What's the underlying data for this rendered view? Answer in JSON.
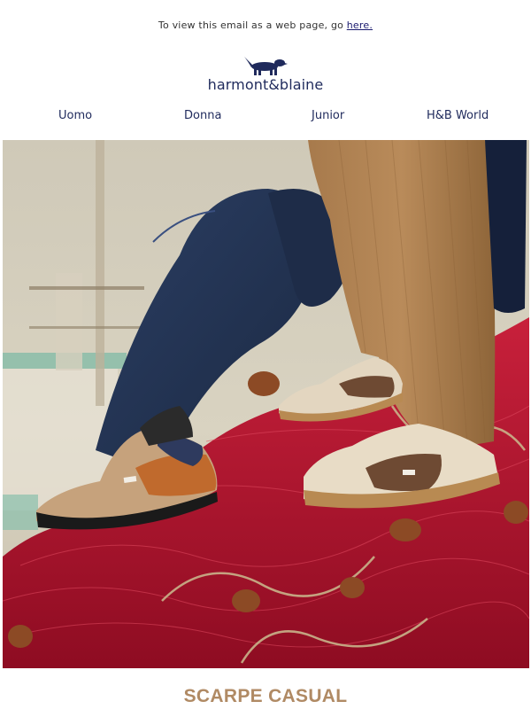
{
  "preheader": {
    "text": "To view this email as a web page, go",
    "link_label": "here."
  },
  "logo": {
    "wordmark": "harmont&blaine",
    "icon": "dachshund-icon"
  },
  "nav": {
    "items": [
      {
        "label": "Uomo"
      },
      {
        "label": "Donna"
      },
      {
        "label": "Junior"
      },
      {
        "label": "H&B World"
      }
    ]
  },
  "hero": {
    "image_subject": "hero-image"
  },
  "section": {
    "title": "SCARPE CASUAL"
  },
  "colors": {
    "brand_navy": "#1f2a5c",
    "accent_tan": "#b08a64",
    "net_red": "#b0122c"
  }
}
